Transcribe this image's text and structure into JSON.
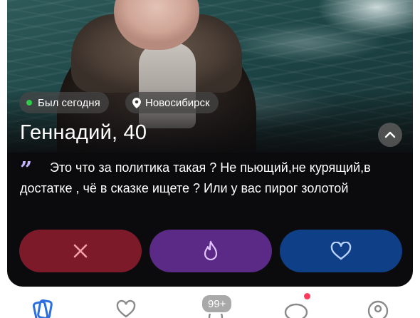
{
  "profile": {
    "status_tag": "Был сегодня",
    "city_tag": "Новосибирск",
    "name_age": "Геннадий, 40",
    "bio": "Это что за политика такая ? Не пьющий,не курящий,в достатке , чё в сказке ищете ? Или у вас пирог золотой"
  },
  "colors": {
    "online_dot": "#2fcc4a",
    "quote_mark": "#c4b4ff",
    "dislike_bg": "#7d1a2a",
    "superlike_bg": "#5a2a86",
    "like_bg": "#0f3f86",
    "tab_active": "#2d6fe0",
    "tab_inactive": "#8a8a8a",
    "notification_dot": "#ff3b5c"
  },
  "icons": {
    "status": "online-dot",
    "city": "location-pin-icon",
    "expand": "chevron-up-icon",
    "quote": "quote-icon",
    "dislike": "close-icon",
    "superlike": "flame-icon",
    "like": "heart-icon"
  },
  "tabbar": {
    "items": [
      {
        "icon": "cards-icon",
        "active": true
      },
      {
        "icon": "likes-icon",
        "active": false
      },
      {
        "icon": "matches-icon",
        "active": false,
        "badge": "99+"
      },
      {
        "icon": "chat-icon",
        "active": false,
        "has_dot": true
      },
      {
        "icon": "profile-icon",
        "active": false
      }
    ]
  }
}
